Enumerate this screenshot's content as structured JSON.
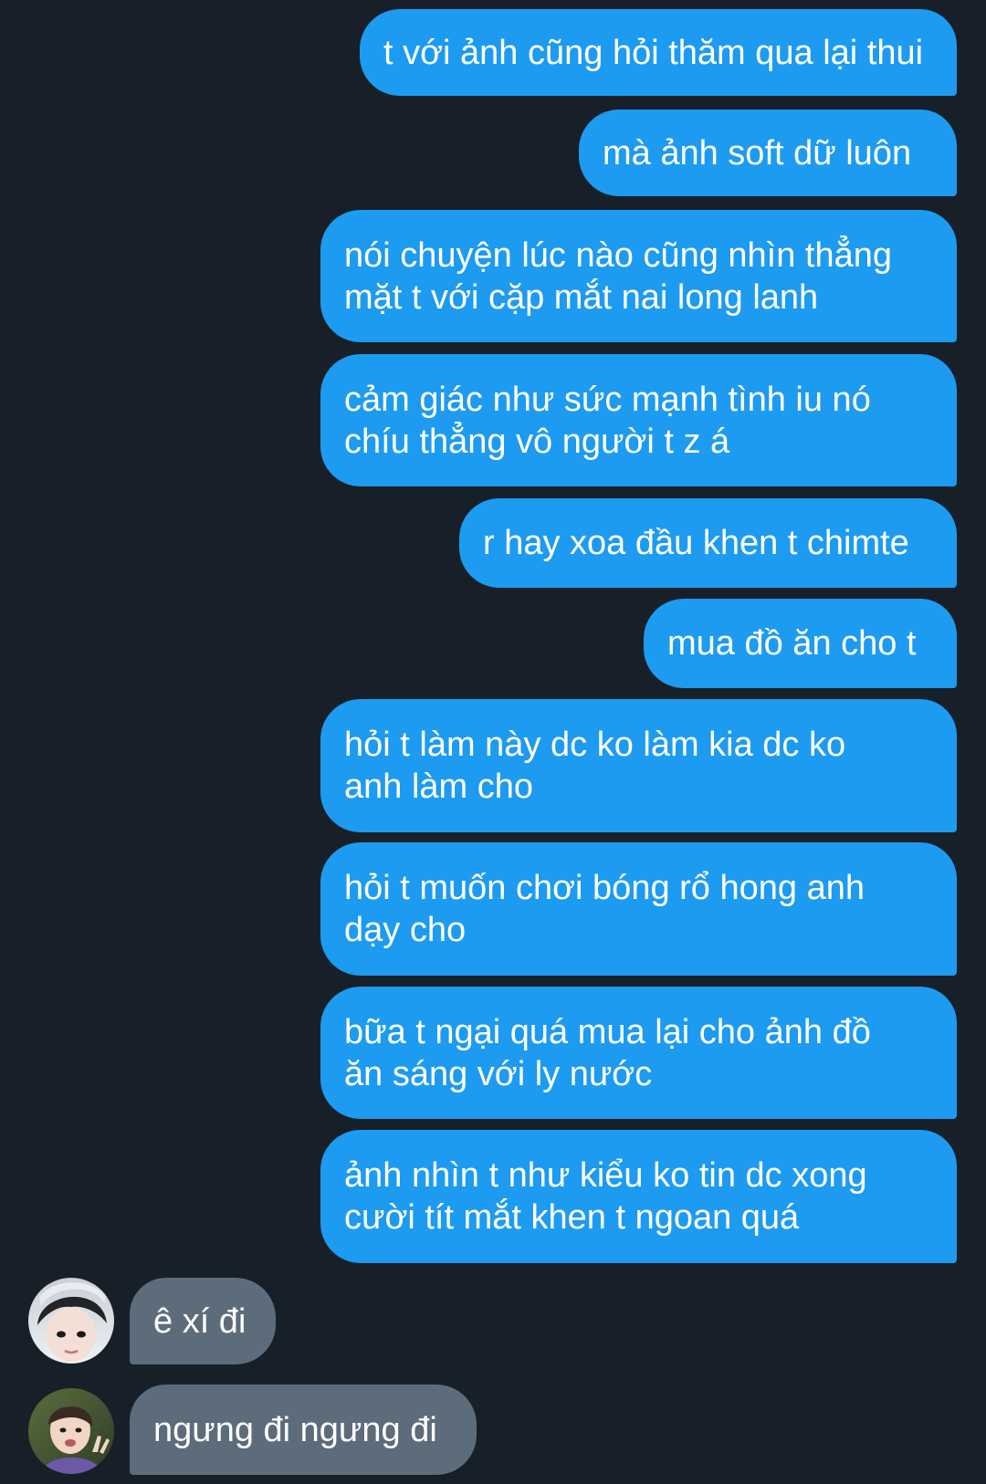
{
  "colors": {
    "background": "#172029",
    "outgoing_bubble": "#1d9bf0",
    "incoming_bubble": "#5d6c7b",
    "text": "#ffffff"
  },
  "messages": [
    {
      "direction": "out",
      "lines": [
        "t với ảnh cũng hỏi thăm qua lại thui"
      ]
    },
    {
      "direction": "out",
      "lines": [
        "mà ảnh soft dữ luôn"
      ]
    },
    {
      "direction": "out",
      "lines": [
        "nói chuyện lúc nào cũng nhìn thẳng",
        "mặt t với cặp mắt nai long lanh"
      ]
    },
    {
      "direction": "out",
      "lines": [
        "cảm giác như sức mạnh tình iu nó",
        "chíu thẳng vô người t z á"
      ]
    },
    {
      "direction": "out",
      "lines": [
        "r hay xoa đầu khen t chimte"
      ]
    },
    {
      "direction": "out",
      "lines": [
        "mua đồ ăn cho t"
      ]
    },
    {
      "direction": "out",
      "lines": [
        "hỏi t làm này dc ko làm kia dc ko",
        "anh làm cho"
      ]
    },
    {
      "direction": "out",
      "lines": [
        "hỏi t muốn chơi bóng rổ hong anh",
        "dạy cho"
      ]
    },
    {
      "direction": "out",
      "lines": [
        "bữa t ngại quá mua lại cho ảnh đồ",
        "ăn sáng với ly nước"
      ]
    },
    {
      "direction": "out",
      "lines": [
        "ảnh nhìn t như kiểu ko tin dc xong",
        "cười tít mắt khen t ngoan quá"
      ]
    },
    {
      "direction": "in",
      "avatar": "avatar-1",
      "lines": [
        "ê xí đi"
      ]
    },
    {
      "direction": "in",
      "avatar": "avatar-2",
      "lines": [
        "ngưng đi ngưng đi"
      ]
    }
  ]
}
